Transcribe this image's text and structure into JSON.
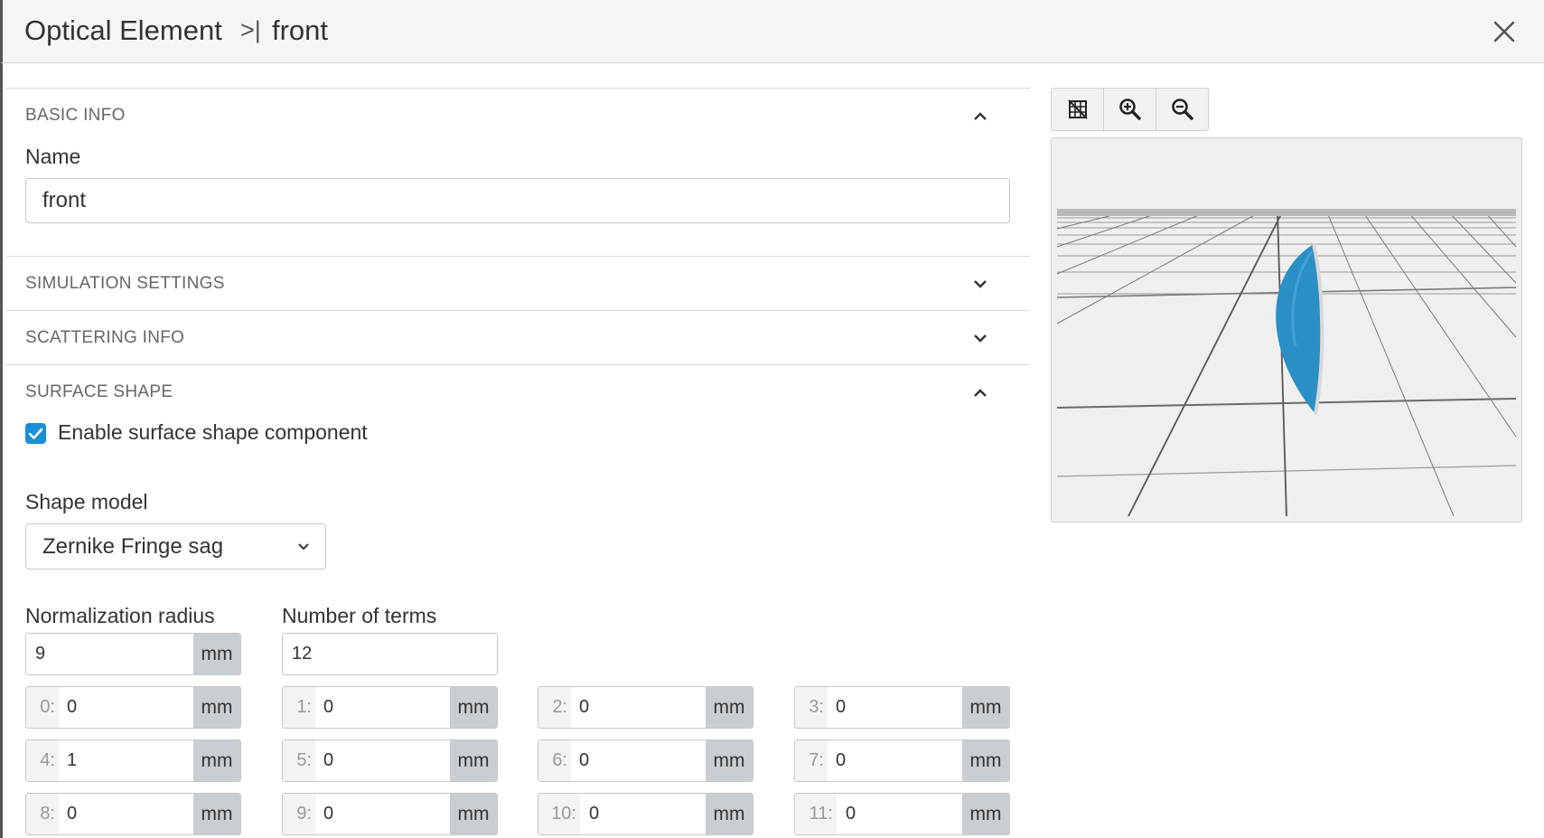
{
  "header": {
    "title": "Optical Element",
    "separator": ">|",
    "subtitle": "front",
    "close_icon": "close-icon"
  },
  "basic_info": {
    "title": "BASIC INFO",
    "name_label": "Name",
    "name_value": "front"
  },
  "simulation_settings": {
    "title": "SIMULATION SETTINGS"
  },
  "scattering_info": {
    "title": "SCATTERING INFO"
  },
  "surface_shape": {
    "title": "SURFACE SHAPE",
    "enable_label": "Enable surface shape component",
    "enable_checked": true,
    "shape_model_label": "Shape model",
    "shape_model_value": "Zernike Fringe sag",
    "norm_radius_label": "Normalization radius",
    "norm_radius_value": "9",
    "norm_radius_unit": "mm",
    "num_terms_label": "Number of terms",
    "num_terms_value": "12",
    "terms": [
      {
        "idx": "0:",
        "value": "0",
        "unit": "mm"
      },
      {
        "idx": "1:",
        "value": "0",
        "unit": "mm"
      },
      {
        "idx": "2:",
        "value": "0",
        "unit": "mm"
      },
      {
        "idx": "3:",
        "value": "0",
        "unit": "mm"
      },
      {
        "idx": "4:",
        "value": "1",
        "unit": "mm"
      },
      {
        "idx": "5:",
        "value": "0",
        "unit": "mm"
      },
      {
        "idx": "6:",
        "value": "0",
        "unit": "mm"
      },
      {
        "idx": "7:",
        "value": "0",
        "unit": "mm"
      },
      {
        "idx": "8:",
        "value": "0",
        "unit": "mm"
      },
      {
        "idx": "9:",
        "value": "0",
        "unit": "mm"
      },
      {
        "idx": "10:",
        "value": "0",
        "unit": "mm"
      },
      {
        "idx": "11:",
        "value": "0",
        "unit": "mm"
      }
    ]
  },
  "viewer": {
    "tools": [
      "grid-toggle-icon",
      "zoom-in-icon",
      "zoom-out-icon"
    ],
    "lens_color": "#2a8fc4",
    "background_color": "#efefef"
  },
  "colors": {
    "accent": "#1a8fd6",
    "unit_bg": "#c9ced2"
  }
}
